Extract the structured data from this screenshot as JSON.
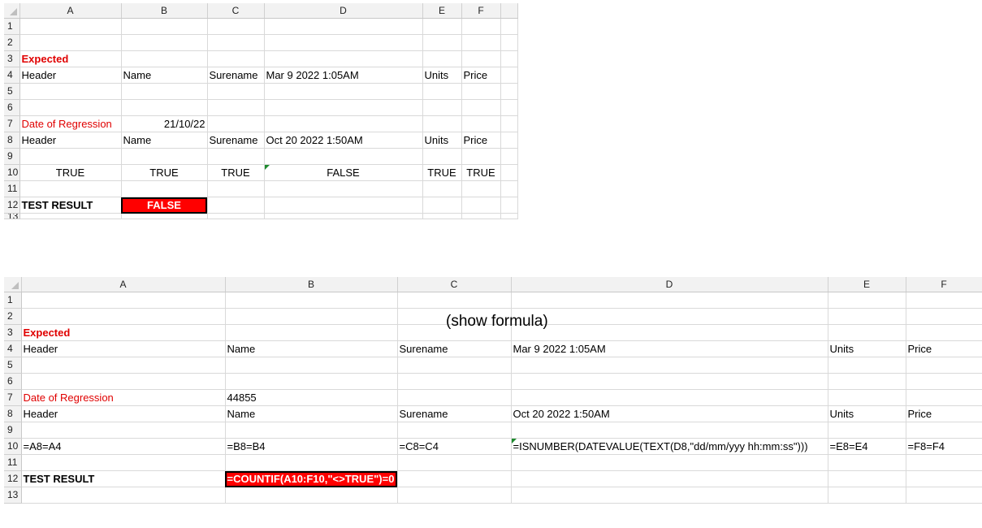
{
  "top_sheet": {
    "columns": [
      "A",
      "B",
      "C",
      "D",
      "E",
      "F"
    ],
    "row_numbers": [
      "1",
      "2",
      "3",
      "4",
      "5",
      "6",
      "7",
      "8",
      "9",
      "10",
      "11",
      "12",
      "13"
    ],
    "cells": {
      "A3": "Expected",
      "A4": "Header",
      "B4": "Name",
      "C4": "Surename",
      "D4": "Mar 9 2022 1:05AM",
      "E4": "Units",
      "F4": "Price",
      "A7": "Date of Regression",
      "B7": "21/10/22",
      "A8": "Header",
      "B8": "Name",
      "C8": "Surename",
      "D8": "Oct 20 2022 1:50AM",
      "E8": "Units",
      "F8": "Price",
      "A10": "TRUE",
      "B10": "TRUE",
      "C10": "TRUE",
      "D10": "FALSE",
      "E10": "TRUE",
      "F10": "TRUE",
      "A12": "TEST RESULT",
      "B12": "FALSE"
    }
  },
  "bottom_sheet": {
    "columns": [
      "A",
      "B",
      "C",
      "D",
      "E",
      "F"
    ],
    "row_numbers": [
      "1",
      "2",
      "3",
      "4",
      "5",
      "6",
      "7",
      "8",
      "9",
      "10",
      "11",
      "12",
      "13"
    ],
    "note": "(show formula)",
    "cells": {
      "A3": "Expected",
      "A4": "Header",
      "B4": "Name",
      "C4": "Surename",
      "D4": "Mar 9 2022 1:05AM",
      "E4": "Units",
      "F4": "Price",
      "A7": "Date of Regression",
      "B7": "44855",
      "A8": "Header",
      "B8": "Name",
      "C8": "Surename",
      "D8": "Oct 20 2022 1:50AM",
      "E8": "Units",
      "F8": "Price",
      "A10": "=A8=A4",
      "B10": "=B8=B4",
      "C10": "=C8=C4",
      "D10": "=ISNUMBER(DATEVALUE(TEXT(D8,\"dd/mm/yyy hh:mm:ss\")))",
      "E10": "=E8=E4",
      "F10": "=F8=F4",
      "A12": "TEST RESULT",
      "B12": "=COUNTIF(A10:F10,\"<>TRUE\")=0"
    }
  },
  "colors": {
    "red_text": "#e00000",
    "fail_fill": "#ff0000",
    "error_flag": "#1e8a2e"
  }
}
